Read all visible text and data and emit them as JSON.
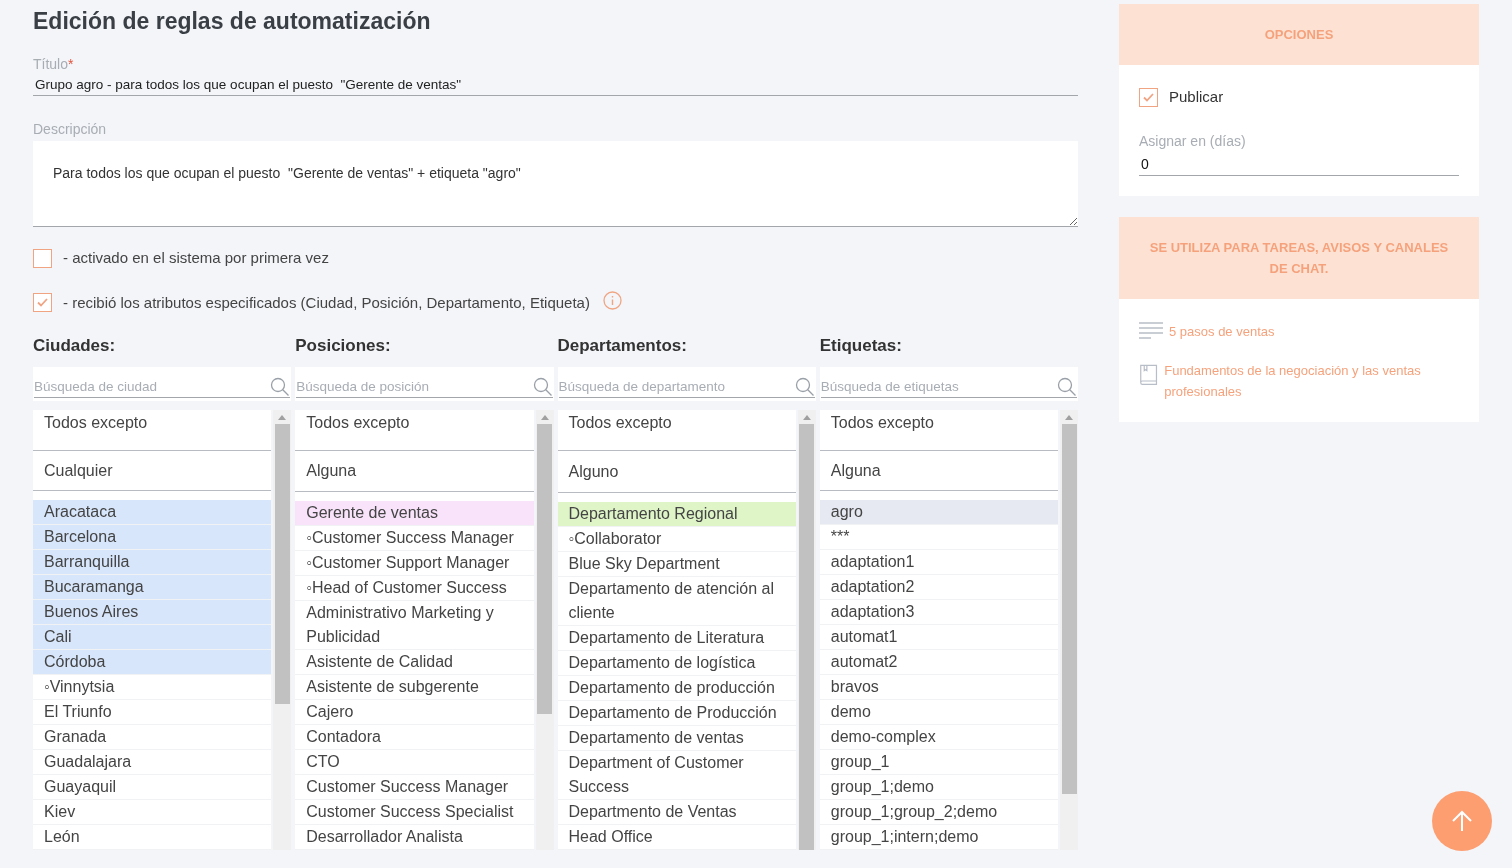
{
  "page": {
    "title": "Edición de reglas de automatización"
  },
  "title_field": {
    "label": "Título",
    "required_mark": "*",
    "value": "Grupo agro - para todos los que ocupan el puesto  \"Gerente de ventas\""
  },
  "description_field": {
    "label": "Descripción",
    "value": "Para todos los que ocupan el puesto  \"Gerente de ventas\" + etiqueta \"agro\""
  },
  "conditions": [
    {
      "label": "- activado en el sistema por primera vez",
      "checked": false,
      "info": false
    },
    {
      "label": "- recibió los atributos especificados (Ciudad, Posición, Departamento, Etiqueta)",
      "checked": true,
      "info": true
    }
  ],
  "filters": [
    {
      "heading": "Ciudades:",
      "search_placeholder": "Búsqueda de ciudad",
      "color": "#d7e6fb",
      "options": [
        "Todos excepto",
        "Cualquier"
      ],
      "items": [
        {
          "label": "Aracataca",
          "selected": true
        },
        {
          "label": "Barcelona",
          "selected": true
        },
        {
          "label": "Barranquilla",
          "selected": true
        },
        {
          "label": "Bucaramanga",
          "selected": true
        },
        {
          "label": "Buenos Aires",
          "selected": true
        },
        {
          "label": "Cali",
          "selected": true
        },
        {
          "label": "Córdoba",
          "selected": true
        },
        {
          "label": "◦Vinnytsia",
          "selected": false
        },
        {
          "label": "El Triunfo",
          "selected": false
        },
        {
          "label": "Granada",
          "selected": false
        },
        {
          "label": "Guadalajara",
          "selected": false
        },
        {
          "label": "Guayaquil",
          "selected": false
        },
        {
          "label": "Kiev",
          "selected": false
        },
        {
          "label": "León",
          "selected": false
        }
      ]
    },
    {
      "heading": "Posiciones:",
      "search_placeholder": "Búsqueda de posición",
      "color": "#f8e3fa",
      "options": [
        "Todos excepto",
        "Alguna"
      ],
      "items": [
        {
          "label": "Gerente de ventas",
          "selected": true
        },
        {
          "label": "◦Customer Success Manager",
          "selected": false
        },
        {
          "label": "◦Customer Support Manager",
          "selected": false
        },
        {
          "label": "◦Head of Customer Success",
          "selected": false
        },
        {
          "label": "Administrativo Marketing y Publicidad",
          "selected": false
        },
        {
          "label": "Asistente de Calidad",
          "selected": false
        },
        {
          "label": "Asistente de subgerente",
          "selected": false
        },
        {
          "label": "Cajero",
          "selected": false
        },
        {
          "label": "Contadora",
          "selected": false
        },
        {
          "label": "CTO",
          "selected": false
        },
        {
          "label": "Customer Success Manager",
          "selected": false
        },
        {
          "label": "Customer Success Specialist",
          "selected": false
        },
        {
          "label": "Desarrollador Analista",
          "selected": false
        }
      ]
    },
    {
      "heading": "Departamentos:",
      "search_placeholder": "Búsqueda de departamento",
      "color": "#dff5c8",
      "options": [
        "Todos excepto",
        "Alguno"
      ],
      "items": [
        {
          "label": "Departamento Regional",
          "selected": true
        },
        {
          "label": "◦Collaborator",
          "selected": false
        },
        {
          "label": "Blue Sky Department",
          "selected": false
        },
        {
          "label": "Departamento de atención al cliente",
          "selected": false
        },
        {
          "label": "Departamento de Literatura",
          "selected": false
        },
        {
          "label": "Departamento de logística",
          "selected": false
        },
        {
          "label": "Departamento de producción",
          "selected": false
        },
        {
          "label": "Departamento de Producción",
          "selected": false
        },
        {
          "label": "Departamento de ventas",
          "selected": false
        },
        {
          "label": "Department of Customer Success",
          "selected": false
        },
        {
          "label": "Departmento de Ventas",
          "selected": false
        },
        {
          "label": "Head Office",
          "selected": false
        }
      ]
    },
    {
      "heading": "Etiquetas:",
      "search_placeholder": "Búsqueda de etiquetas",
      "color": "#e6e8f2",
      "options": [
        "Todos excepto",
        "Alguna"
      ],
      "items": [
        {
          "label": "agro",
          "selected": true
        },
        {
          "label": "***",
          "selected": false
        },
        {
          "label": "adaptation1",
          "selected": false
        },
        {
          "label": "adaptation2",
          "selected": false
        },
        {
          "label": "adaptation3",
          "selected": false
        },
        {
          "label": "automat1",
          "selected": false
        },
        {
          "label": "automat2",
          "selected": false
        },
        {
          "label": "bravos",
          "selected": false
        },
        {
          "label": "demo",
          "selected": false
        },
        {
          "label": "demo-complex",
          "selected": false
        },
        {
          "label": "group_1",
          "selected": false
        },
        {
          "label": "group_1;demo",
          "selected": false
        },
        {
          "label": "group_1;group_2;demo",
          "selected": false
        },
        {
          "label": "group_1;intern;demo",
          "selected": false
        }
      ]
    }
  ],
  "options_panel": {
    "header": "OPCIONES",
    "publish": {
      "label": "Publicar",
      "checked": true
    },
    "assign_field": {
      "label": "Asignar en (días)",
      "value": "0"
    }
  },
  "usage_panel": {
    "header": "SE UTILIZA PARA TAREAS, AVISOS Y CANALES DE CHAT.",
    "links": [
      {
        "kind": "steps",
        "text": "5 pasos de ventas"
      },
      {
        "kind": "course",
        "text": "Fundamentos de la negociación y las ventas profesionales"
      }
    ]
  }
}
